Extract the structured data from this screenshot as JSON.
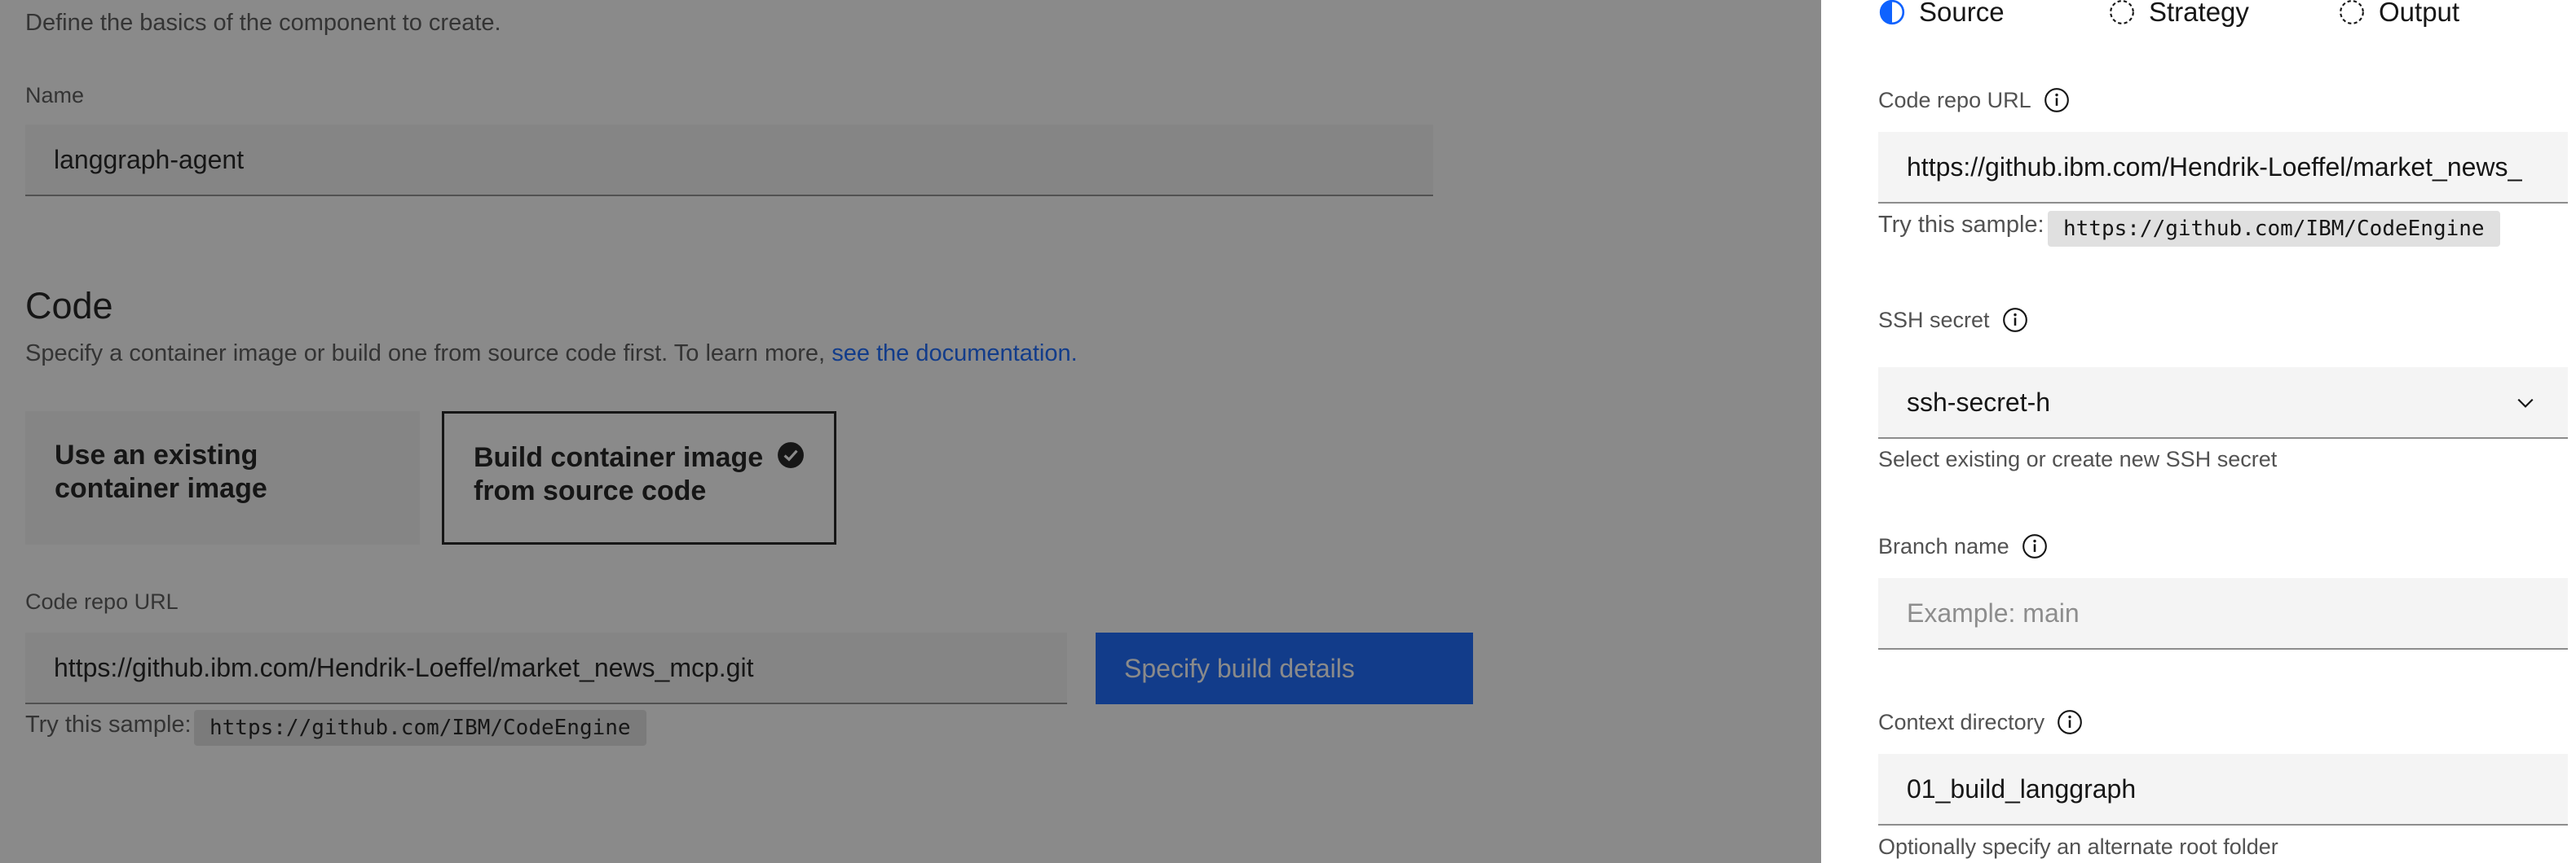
{
  "component": {
    "description": "Define the basics of the component to create.",
    "name_label": "Name",
    "name_value": "langgraph-agent"
  },
  "code": {
    "title": "Code",
    "description": "Specify a container image or build one from source code first. To learn more,",
    "doc_link": "see the documentation.",
    "tiles": [
      {
        "label": "Use an existing container image",
        "selected": false
      },
      {
        "label": "Build container image from source code",
        "selected": true
      }
    ],
    "repo_label": "Code repo URL",
    "repo_value": "https://github.ibm.com/Hendrik-Loeffel/market_news_mcp.git",
    "build_button": "Specify build details",
    "sample_label": "Try this sample:",
    "sample_value": "https://github.com/IBM/CodeEngine"
  },
  "panel": {
    "steps": [
      {
        "label": "Source",
        "state": "current"
      },
      {
        "label": "Strategy",
        "state": "incomplete"
      },
      {
        "label": "Output",
        "state": "incomplete"
      }
    ],
    "repo_label": "Code repo URL",
    "repo_value": "https://github.ibm.com/Hendrik-Loeffel/market_news_",
    "sample_label": "Try this sample:",
    "sample_value": "https://github.com/IBM/CodeEngine",
    "ssh_label": "SSH secret",
    "ssh_value": "ssh-secret-h",
    "ssh_helper": "Select existing or create new SSH secret",
    "branch_label": "Branch name",
    "branch_placeholder": "Example: main",
    "context_label": "Context directory",
    "context_value": "01_build_langgraph",
    "context_helper": "Optionally specify an alternate root folder"
  },
  "colors": {
    "accent": "#0f62fe",
    "overlay": "#161616"
  }
}
